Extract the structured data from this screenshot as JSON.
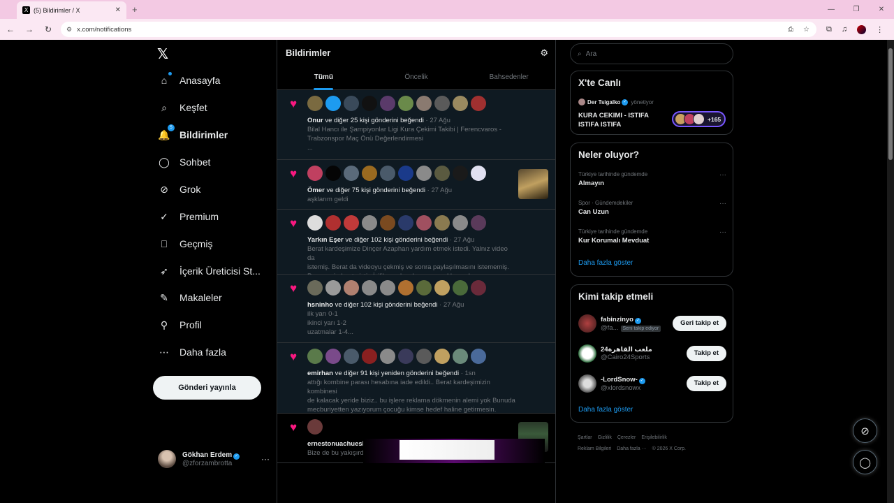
{
  "browser": {
    "tab_title": "(5) Bildirimler / X",
    "tab_favicon": "X",
    "new_tab": "+",
    "url": "x.com/notifications",
    "tab_close": "✕"
  },
  "sidebar": {
    "logo": "𝕏",
    "items": [
      {
        "label": "Anasayfa",
        "icon": "home-icon",
        "glyph": "⌂"
      },
      {
        "label": "Keşfet",
        "icon": "search-icon",
        "glyph": "⌕"
      },
      {
        "label": "Bildirimler",
        "icon": "bell-icon",
        "glyph": "🔔",
        "badge": "5"
      },
      {
        "label": "Sohbet",
        "icon": "chat-icon",
        "glyph": "◯"
      },
      {
        "label": "Grok",
        "icon": "grok-icon",
        "glyph": "⊘"
      },
      {
        "label": "Premium",
        "icon": "verified-icon",
        "glyph": "✓"
      },
      {
        "label": "Geçmiş",
        "icon": "bookmark-icon",
        "glyph": "⎕"
      },
      {
        "label": "İçerik Üreticisi St...",
        "icon": "rocket-icon",
        "glyph": "➶"
      },
      {
        "label": "Makaleler",
        "icon": "article-icon",
        "glyph": "✎"
      },
      {
        "label": "Profil",
        "icon": "profile-icon",
        "glyph": "⚲"
      },
      {
        "label": "Daha fazla",
        "icon": "more-circle-icon",
        "glyph": "⋯"
      }
    ],
    "post_button": "Gönderi yayınla",
    "user": {
      "name": "Gökhan Erdem",
      "handle": "@zforzambrotta",
      "more": "···"
    }
  },
  "center": {
    "title": "Bildirimler",
    "tabs": [
      "Tümü",
      "Öncelik",
      "Bahsedenler"
    ],
    "notifications": [
      {
        "who": "Onur",
        "action": " ve diğer 25 kişi gönderini beğendi",
        "time": " · 27 Ağu",
        "excerpt": "Bilal Hancı ile Şampiyonlar Ligi Kura Çekimi Takibi | Ferencvaros -\nTrabzonspor Maç Önü Değerlendirmesi\n...",
        "avatars": [
          "#7a6a40",
          "#1d9bf0",
          "#3a4a5a",
          "#111111",
          "#5a3a6a",
          "#6a8a4a",
          "#8a7a70",
          "#5a5a5a",
          "#9a8a60",
          "#a03030"
        ]
      },
      {
        "who": "Ömer",
        "action": " ve diğer 75 kişi gönderini beğendi",
        "time": " · 27 Ağu",
        "excerpt": "aşklarım geldi",
        "avatars": [
          "#c04060",
          "#050505",
          "#5a6a7a",
          "#9a6a20",
          "#4a5a6a",
          "#1a3a8a",
          "#8a8a8a",
          "#5a5a40",
          "#1a1a1a",
          "#e0e0f0"
        ]
      },
      {
        "who": "Yarkın Eşer",
        "action": " ve diğer 102 kişi gönderini beğendi",
        "time": " · 27 Ağu",
        "excerpt": "Berat kardeşimize Dinçer Azaphan yardım etmek istedi. Yalnız video da\nistemiş. Berat da videoyu çekmiş ve sonra paylaşılmasını istememiş.\nParasını iade etmiştir. İyilik yapılacaksa onun reklamı olmaz. Yakışmadı. ...",
        "avatars": [
          "#dddddd",
          "#b03030",
          "#c03a3a",
          "#8a8a8a",
          "#7a4a20",
          "#2a3a6a",
          "#a05060",
          "#8a7a50",
          "#8a8a8a",
          "#5a3a5a"
        ]
      },
      {
        "who": "hsninho",
        "action": " ve diğer 102 kişi gönderini beğendi",
        "time": " · 27 Ağu",
        "excerpt": "ilk yarı 0-1\nikinci yarı 1-2\nuzatmalar 1-4...",
        "avatars": [
          "#6a6a5a",
          "#9a9a9a",
          "#b08070",
          "#8a8a8a",
          "#8a8a8a",
          "#b07030",
          "#5a6a3a",
          "#c0a060",
          "#4a6a3a",
          "#6a2a3a"
        ]
      },
      {
        "who": "emirhan",
        "action": " ve diğer 91 kişi yeniden gönderini beğendi",
        "time": " · 1sn",
        "excerpt": "attığı kombine parası hesabına iade edildi.. Berat kardeşimizin kombinesi\nde kalacak yeride biziz.. bu işlere reklama dökmenin alemi yok Bunuda\nmecburiyetten yazıyorum çocuğu kimse hedef haline getirmesin.",
        "avatars": [
          "#5a7a4a",
          "#7a4a8a",
          "#4a5a6a",
          "#8a2020",
          "#8a8a8a",
          "#3a3a5a",
          "#5a5a5a",
          "#c0a060",
          "#6a8a7a",
          "#4a6a9a"
        ]
      },
      {
        "who": "ernestonuachueskihellaç",
        "action": " gönderini beğendi",
        "time": " · 1d",
        "excerpt": "Bize de bu yakışırdı. Teşekkürler çocukluk aşkım @Trabzonspor",
        "avatars": [
          "#6a3a3a"
        ]
      }
    ]
  },
  "right": {
    "search_placeholder": "Ara",
    "live": {
      "title": "X'te Canlı",
      "host": "Der Tsigalko",
      "role": "yönetiyor",
      "space_title": "KURA CEKIMI - ISTIFA ISTIFA ISTIFA",
      "count": "+165"
    },
    "trends": {
      "title": "Neler oluyor?",
      "items": [
        {
          "context": "Türkiye tarihinde gündemde",
          "name": "Almayın"
        },
        {
          "context": "Spor · Gündemdekiler",
          "name": "Can Uzun"
        },
        {
          "context": "Türkiye tarihinde gündemde",
          "name": "Kur Korumalı Mevduat"
        }
      ],
      "show_more": "Daha fazla göster"
    },
    "who_to_follow": {
      "title": "Kimi takip etmeli",
      "items": [
        {
          "name": "fabinzinyo",
          "handle": "@fa...",
          "tag": "Seni takip ediyor",
          "button": "Geri takip et",
          "verified": true
        },
        {
          "name": "ملعب القاهرة24",
          "handle": "@Cairo24Sports",
          "tag": "",
          "button": "Takip et",
          "verified": false
        },
        {
          "name": "-LordSnow-",
          "handle": "@xlordsnowx",
          "tag": "",
          "button": "Takip et",
          "verified": true
        }
      ],
      "show_more": "Daha fazla göster"
    },
    "footer": {
      "line1": [
        "Şartlar",
        "Gizlilik",
        "Çerezler",
        "Erişilebilirlik"
      ],
      "line2": [
        "Reklam Bilgileri",
        "Daha fazla ···",
        "© 2026 X Corp."
      ]
    }
  },
  "colors": {
    "accent": "#1d9bf0",
    "like": "#f91880",
    "live_border": "#7856ff"
  }
}
